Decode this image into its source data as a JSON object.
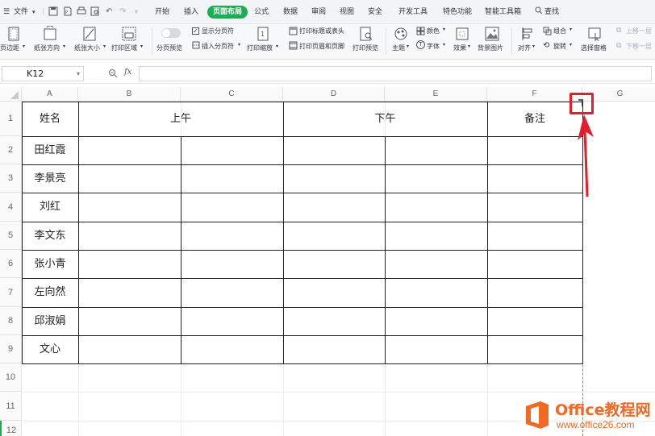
{
  "menu": {
    "file": "文件",
    "tabs": [
      "开始",
      "插入",
      "页面布局",
      "公式",
      "数据",
      "审阅",
      "视图",
      "安全",
      "开发工具",
      "特色功能",
      "智能工具箱"
    ],
    "active_tab": "页面布局",
    "search": "查找"
  },
  "ribbon": {
    "margins": "页边距",
    "orientation": "纸张方向",
    "size": "纸张大小",
    "print_area": "打印区域",
    "page_break_preview": "分页预览",
    "show_page_breaks": "显示分页符",
    "insert_page_break": "插入分页符",
    "print_scaling": "打印缩放",
    "print_titles": "打印标题或表头",
    "print_header_footer": "打印页眉和页脚",
    "print_preview": "打印预览",
    "theme": "主题",
    "colors": "颜色",
    "fonts": "字体",
    "effects": "效果",
    "background": "背景图片",
    "align": "对齐",
    "group": "组合",
    "rotate": "旋转",
    "selection_pane": "选择窗格",
    "bring_forward": "上移一层",
    "send_backward": "下移一层"
  },
  "formula_bar": {
    "cell_ref": "K12",
    "fx": "fx",
    "value": ""
  },
  "sheet": {
    "columns": [
      "A",
      "B",
      "C",
      "D",
      "E",
      "F",
      "G"
    ],
    "rows": [
      "1",
      "2",
      "3",
      "4",
      "5",
      "6",
      "7",
      "8",
      "9",
      "10",
      "11",
      "12"
    ],
    "header": {
      "name": "姓名",
      "morning": "上午",
      "afternoon": "下午",
      "remark": "备注"
    },
    "names": [
      "田红霞",
      "李景亮",
      "刘红",
      "李文东",
      "张小青",
      "左向然",
      "邱淑娟",
      "文心"
    ]
  },
  "watermark": {
    "brand": "Office教程网",
    "url": "www.office26.com"
  },
  "colors": {
    "accent_green": "#1aad54",
    "highlight_red": "#e21f2d",
    "watermark_orange": "#f06a25"
  }
}
